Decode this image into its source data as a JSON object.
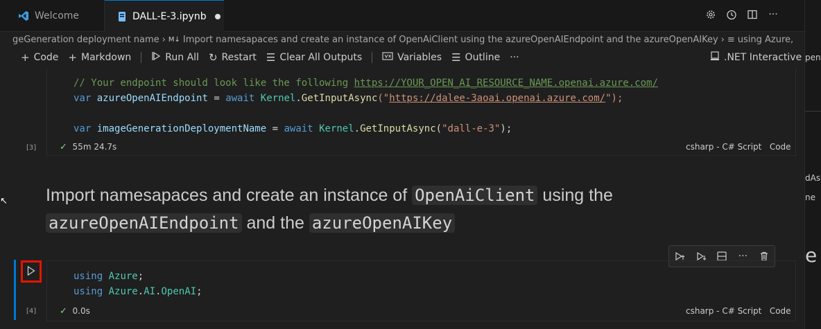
{
  "tabs": [
    {
      "label": "Welcome",
      "icon": "vscode-logo-icon"
    },
    {
      "label": "DALL-E-3.ipynb",
      "icon": "notebook-icon",
      "modified": true
    }
  ],
  "breadcrumb": {
    "part1": "geGeneration deployment name",
    "part2": "Import namesapaces and create an instance of OpenAiClient using the azureOpenAIEndpoint and the azureOpenAIKey",
    "part3": "using Azure,"
  },
  "toolbar": {
    "code": "Code",
    "markdown": "Markdown",
    "run_all": "Run All",
    "restart": "Restart",
    "clear": "Clear All Outputs",
    "variables": "Variables",
    "outline": "Outline",
    "more": "···",
    "kernel": ".NET Interactive"
  },
  "cell3": {
    "line1_comment": "// Your endpoint should look like the following ",
    "line1_url": "https://YOUR_OPEN_AI_RESOURCE_NAME.openai.azure.com/",
    "line2_var": "var",
    "line2_id": "azureOpenAIEndpoint",
    "line2_eq": " = ",
    "line2_await": "await",
    "line2_kernel": "Kernel",
    "line2_dot": ".",
    "line2_fn": "GetInputAsync",
    "line2_open": "(\"",
    "line2_str": "https://dalee-3aoai.openai.azure.com/",
    "line2_close": "\");",
    "line3_var": "var",
    "line3_id": "imageGenerationDeploymentName",
    "line3_eq": " = ",
    "line3_await": "await",
    "line3_kernel": "Kernel",
    "line3_dot": ".",
    "line3_fn": "GetInputAsync",
    "line3_open": "(",
    "line3_str": "\"dall-e-3\"",
    "line3_close": ");",
    "exec_count": "[3]",
    "duration": "55m 24.7s",
    "lang": "csharp - C# Script",
    "lang2": "Code"
  },
  "markdown": {
    "t1": "Import namesapaces and create an instance of ",
    "c1": "OpenAiClient",
    "t2": " using the",
    "c2": "azureOpenAIEndpoint",
    "t3": " and the ",
    "c3": "azureOpenAIKey"
  },
  "cell4": {
    "line1_kw": "using",
    "line1_ns": "Azure",
    "line1_end": ";",
    "line2_kw": "using",
    "line2_ns1": "Azure",
    "line2_ns2": "AI",
    "line2_ns3": "OpenAI",
    "line2_end": ";",
    "exec_count": "[4]",
    "duration": "0.0s",
    "lang": "csharp - C# Script",
    "lang2": "Code"
  },
  "peek": {
    "t1": "pen",
    "t2": "dAs",
    "t3": "ne",
    "t4": "e"
  },
  "colors": {
    "accent": "#0078d4",
    "highlight_box": "#e51400"
  }
}
